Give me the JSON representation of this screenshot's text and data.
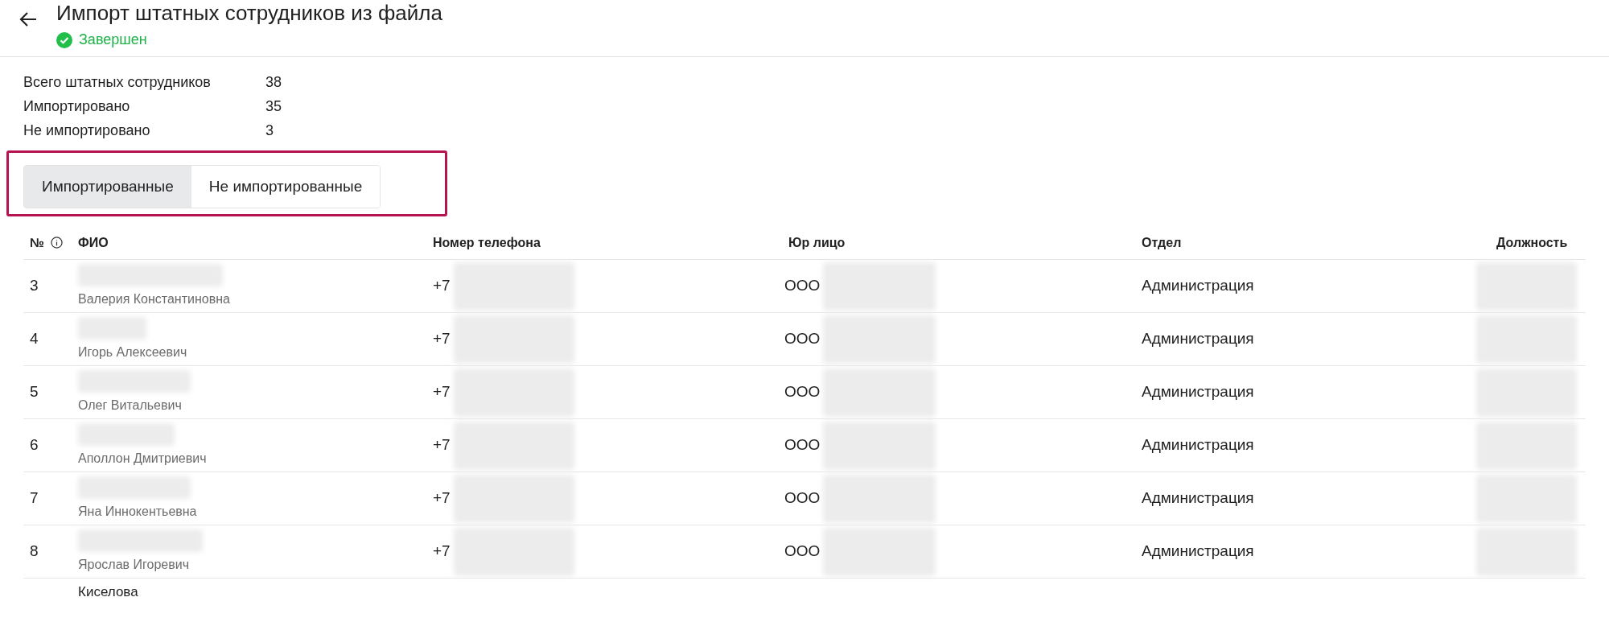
{
  "header": {
    "title": "Импорт штатных сотрудников из файла",
    "status": {
      "label": "Завершен",
      "kind": "done"
    }
  },
  "stats": [
    {
      "label": "Всего штатных сотрудников",
      "value": "38"
    },
    {
      "label": "Импортировано",
      "value": "35"
    },
    {
      "label": "Не импортировано",
      "value": "3"
    }
  ],
  "tabs": [
    {
      "label": "Импортированные",
      "selected": true
    },
    {
      "label": "Не импортированные",
      "selected": false
    }
  ],
  "table": {
    "columns": [
      "№",
      "ФИО",
      "Номер телефона",
      "Юр лицо",
      "Отдел",
      "Должность"
    ],
    "rows": [
      {
        "number": "3",
        "name": "Валерия Константиновна",
        "phone": "+7",
        "company": "ООО",
        "department": "Администрация"
      },
      {
        "number": "4",
        "name": "Игорь Алексеевич",
        "phone": "+7",
        "company": "ООО",
        "department": "Администрация"
      },
      {
        "number": "5",
        "name": "Олег Витальевич",
        "phone": "+7",
        "company": "ООО",
        "department": "Администрация"
      },
      {
        "number": "6",
        "name": "Аполлон Дмитриевич",
        "phone": "+7",
        "company": "ООО",
        "department": "Администрация"
      },
      {
        "number": "7",
        "name": "Яна Иннокентьевна",
        "phone": "+7",
        "company": "ООО",
        "department": "Администрация"
      },
      {
        "number": "8",
        "name": "Ярослав Игоревич",
        "phone": "+7",
        "company": "ООО",
        "department": "Администрация"
      }
    ],
    "partial_row": {
      "surname": "Киселова"
    }
  }
}
